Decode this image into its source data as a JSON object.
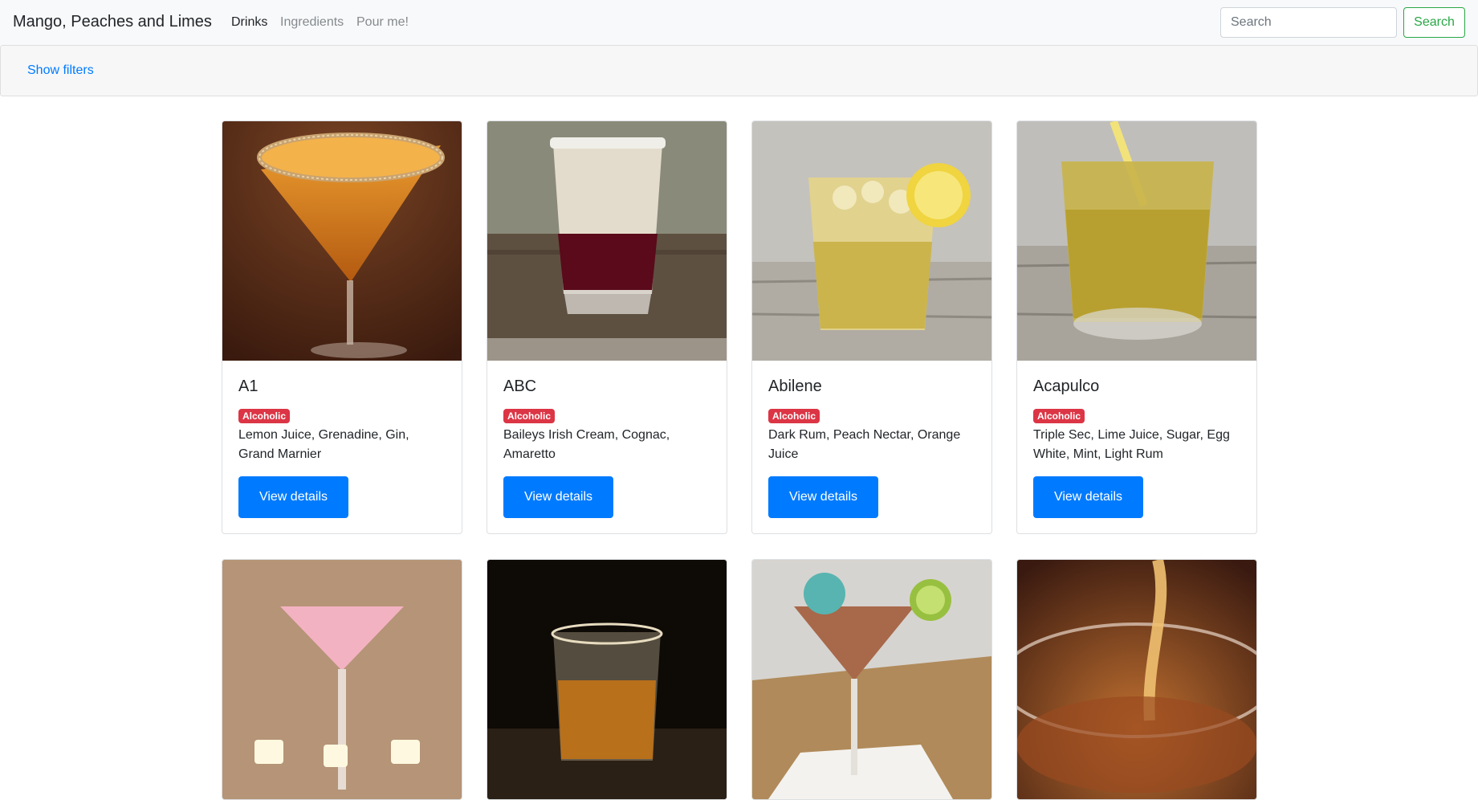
{
  "navbar": {
    "brand": "Mango, Peaches and Limes",
    "links": [
      "Drinks",
      "Ingredients",
      "Pour me!"
    ],
    "search_placeholder": "Search",
    "search_button": "Search",
    "accent_color": "#28a745"
  },
  "filters": {
    "toggle_label": "Show filters"
  },
  "drinks": [
    {
      "name": "A1",
      "category": "Alcoholic",
      "ingredients": "Lemon Juice, Grenadine, Gin, Grand Marnier",
      "button": "View details"
    },
    {
      "name": "ABC",
      "category": "Alcoholic",
      "ingredients": "Baileys Irish Cream, Cognac, Amaretto",
      "button": "View details"
    },
    {
      "name": "Abilene",
      "category": "Alcoholic",
      "ingredients": "Dark Rum, Peach Nectar, Orange Juice",
      "button": "View details"
    },
    {
      "name": "Acapulco",
      "category": "Alcoholic",
      "ingredients": "Triple Sec, Lime Juice, Sugar, Egg White, Mint, Light Rum",
      "button": "View details"
    }
  ],
  "colors": {
    "primary": "#007bff",
    "badge_alcoholic": "#dc3545"
  }
}
